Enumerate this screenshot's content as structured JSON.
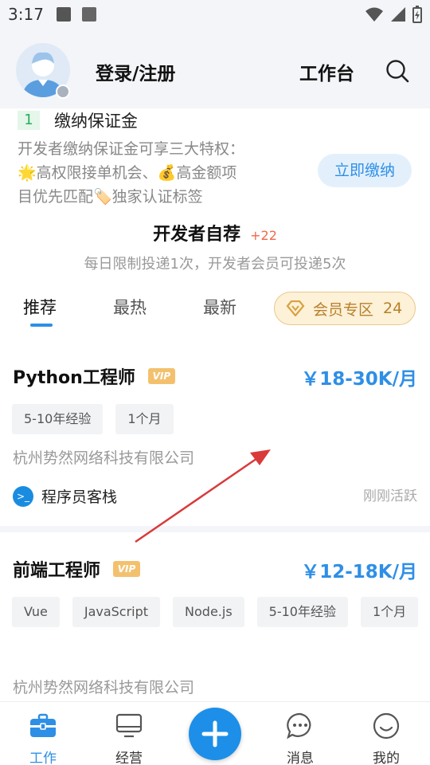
{
  "status_bar": {
    "time": "3:17"
  },
  "header": {
    "login_label": "登录/注册",
    "workbench_label": "工作台"
  },
  "deposit": {
    "step_number": "1",
    "title": "缴纳保证金",
    "desc_line1": "开发者缴纳保证金可享三大特权：",
    "desc_line2": "🌟高权限接单机会、💰高金额项",
    "desc_line3": "目优先匹配🏷️独家认证标签",
    "pay_button": "立即缴纳"
  },
  "recommend": {
    "title": "开发者自荐",
    "count": "+22",
    "subtitle": "每日限制投递1次，开发者会员可投递5次"
  },
  "tabs": {
    "items": [
      {
        "label": "推荐"
      },
      {
        "label": "最热"
      },
      {
        "label": "最新"
      }
    ],
    "active_index": 0,
    "vip_zone": {
      "label": "会员专区",
      "count": "24"
    }
  },
  "jobs": [
    {
      "title": "Python工程师",
      "vip_badge": "VIP",
      "salary": "￥18-30K/月",
      "tags": [
        "5-10年经验",
        "1个月"
      ],
      "company": "杭州势然网络科技有限公司",
      "poster_name": "程序员客栈",
      "active_status": "刚刚活跃"
    },
    {
      "title": "前端工程师",
      "vip_badge": "VIP",
      "salary": "￥12-18K/月",
      "tags": [
        "Vue",
        "JavaScript",
        "Node.js",
        "5-10年经验",
        "1个月"
      ],
      "company": "杭州势然网络科技有限公司"
    }
  ],
  "bottom_nav": {
    "items": [
      {
        "label": "工作",
        "icon": "briefcase-icon",
        "active": true
      },
      {
        "label": "经营",
        "icon": "monitor-icon",
        "active": false
      },
      {
        "label": "消息",
        "icon": "chat-icon",
        "active": false
      },
      {
        "label": "我的",
        "icon": "smile-icon",
        "active": false
      }
    ],
    "fab_icon": "plus-icon"
  },
  "colors": {
    "accent": "#2e8fe6",
    "vip_gold": "#f3c16e",
    "background": "#f3f5f8",
    "annotation_arrow": "#d93a3a"
  }
}
